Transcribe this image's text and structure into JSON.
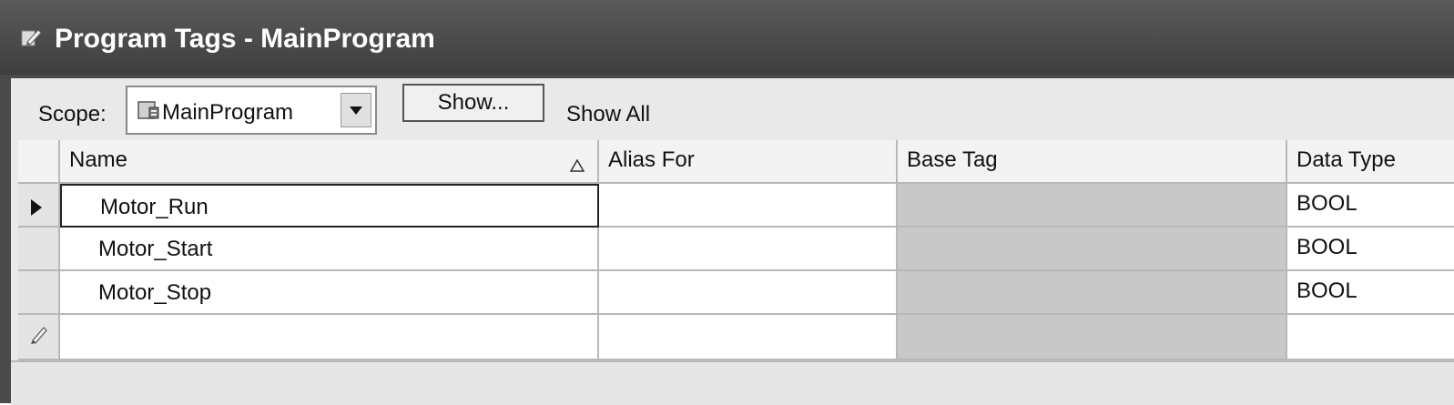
{
  "window": {
    "title": "Program Tags - MainProgram",
    "icon": "pencil-document-icon"
  },
  "toolbar": {
    "scope_label": "Scope:",
    "scope_value": "MainProgram",
    "scope_icon": "program-folder-icon",
    "show_button_label": "Show...",
    "filter_text": "Show All"
  },
  "grid": {
    "columns": [
      "Name",
      "Alias For",
      "Base Tag",
      "Data Type"
    ],
    "sort_column": "Name",
    "sort_indicator": "ascending-triangle-icon",
    "rows": [
      {
        "name": "Motor_Run",
        "alias_for": "",
        "base_tag": "",
        "data_type": "BOOL",
        "current": true
      },
      {
        "name": "Motor_Start",
        "alias_for": "",
        "base_tag": "",
        "data_type": "BOOL",
        "current": false
      },
      {
        "name": "Motor_Stop",
        "alias_for": "",
        "base_tag": "",
        "data_type": "BOOL",
        "current": false
      }
    ],
    "new_row": {
      "name": "",
      "alias_for": "",
      "base_tag": "",
      "data_type": "",
      "marker": "pencil-new-row-icon"
    }
  },
  "colors": {
    "title_bar": "#4a4a4a",
    "title_text": "#ffffff",
    "base_tag_disabled": "#c8c8c8",
    "grid_lines": "#b8b8b8"
  }
}
